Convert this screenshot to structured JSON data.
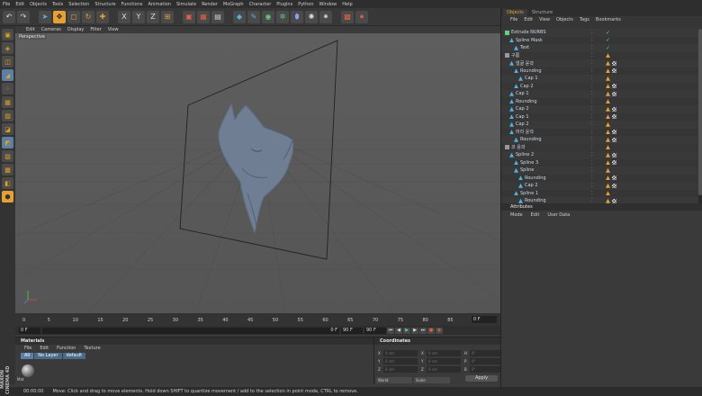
{
  "menubar": [
    "File",
    "Edit",
    "Objects",
    "Tools",
    "Selection",
    "Structure",
    "Functions",
    "Animation",
    "Simulate",
    "Render",
    "MoGraph",
    "Character",
    "Plugins",
    "Python",
    "Window",
    "Help"
  ],
  "toolbar": {
    "icons": [
      "undo-icon",
      "redo-icon",
      "live-select-icon",
      "move-icon",
      "scale-icon",
      "rotate-icon",
      "add-icon",
      "x-axis-icon",
      "y-axis-icon",
      "z-axis-icon",
      "coordinate-system-icon",
      "render-view-icon",
      "render-picture-viewer-icon",
      "render-settings-icon",
      "cube-icon",
      "nurbs-icon",
      "array-icon",
      "deformer-icon",
      "environment-icon",
      "camera-icon",
      "light-icon"
    ],
    "axis_labels": [
      "X",
      "Y",
      "Z"
    ]
  },
  "viewport": {
    "menu": [
      "Edit",
      "Cameras",
      "Display",
      "Filter",
      "View"
    ],
    "label": "Perspective"
  },
  "timeline": {
    "ticks": [
      "0",
      "5",
      "10",
      "15",
      "20",
      "25",
      "30",
      "35",
      "40",
      "45",
      "50",
      "55",
      "60",
      "65",
      "70",
      "75",
      "80",
      "85",
      "90"
    ],
    "current_frame": "0 F",
    "start": "0 F",
    "end_left": "0 F",
    "end": "90 F",
    "end_right": "90 F"
  },
  "materials": {
    "title": "Materials",
    "menu": [
      "File",
      "Edit",
      "Function",
      "Texture"
    ],
    "tabs": [
      "All",
      "No Layer",
      "default"
    ],
    "material_name": "Mat"
  },
  "coordinates": {
    "title": "Coordinates",
    "rows": [
      {
        "axis": "X",
        "pos": "0 cm",
        "axis2": "X",
        "size": "0 cm",
        "axis3": "H",
        "rot": "0°"
      },
      {
        "axis": "Y",
        "pos": "0 cm",
        "axis2": "Y",
        "size": "0 cm",
        "axis3": "P",
        "rot": "0°"
      },
      {
        "axis": "Z",
        "pos": "0 cm",
        "axis2": "Z",
        "size": "0 cm",
        "axis3": "B",
        "rot": "0°"
      }
    ],
    "mode1": "World",
    "mode2": "Scale",
    "apply": "Apply"
  },
  "objects": {
    "tabs": [
      "Objects",
      "Structure"
    ],
    "menu": [
      "File",
      "Edit",
      "View",
      "Objects",
      "Tags",
      "Bookmarks"
    ],
    "items": [
      {
        "name": "Extrude NURBS",
        "depth": 0
      },
      {
        "name": "Spline Mask",
        "depth": 1
      },
      {
        "name": "Text",
        "depth": 2
      },
      {
        "name": "구름",
        "depth": 0
      },
      {
        "name": "얼굴 윤곽",
        "depth": 1
      },
      {
        "name": "Rounding",
        "depth": 2
      },
      {
        "name": "Cap 1",
        "depth": 3
      },
      {
        "name": "Cap 2",
        "depth": 2
      },
      {
        "name": "Cap 1",
        "depth": 1
      },
      {
        "name": "Rounding",
        "depth": 1
      },
      {
        "name": "Cap 2",
        "depth": 1
      },
      {
        "name": "Cap 1",
        "depth": 1
      },
      {
        "name": "Cap 2",
        "depth": 1
      },
      {
        "name": "머리 윤곽",
        "depth": 1
      },
      {
        "name": "Rounding",
        "depth": 2
      },
      {
        "name": "코 윤곽",
        "depth": 0
      },
      {
        "name": "Spline 2",
        "depth": 1
      },
      {
        "name": "Spline 3",
        "depth": 2
      },
      {
        "name": "Spline",
        "depth": 2
      },
      {
        "name": "Rounding",
        "depth": 3
      },
      {
        "name": "Cap 2",
        "depth": 3
      },
      {
        "name": "Spline 1",
        "depth": 2
      },
      {
        "name": "Rounding",
        "depth": 3
      }
    ]
  },
  "attributes": {
    "title": "Attributes",
    "menu": [
      "Mode",
      "Edit",
      "User Data"
    ]
  },
  "status": {
    "time": "00:00:00",
    "message": "Move: Click and drag to move elements. Hold down SHIFT to quantize movement / add to the selection in point mode, CTRL to remove."
  },
  "logo": "MAXON CINEMA 4D",
  "colors": {
    "accent": "#e8a033",
    "selection_blue": "#5a7fa8",
    "object_icon": "#4fb3e0"
  }
}
